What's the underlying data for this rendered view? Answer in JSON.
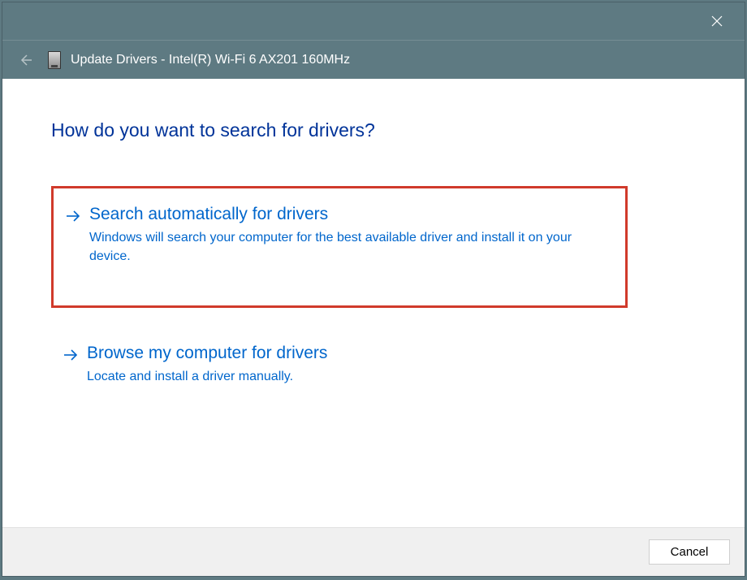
{
  "window": {
    "title": "Update Drivers - Intel(R) Wi-Fi 6 AX201 160MHz"
  },
  "main": {
    "heading": "How do you want to search for drivers?",
    "options": [
      {
        "title": "Search automatically for drivers",
        "description": "Windows will search your computer for the best available driver and install it on your device."
      },
      {
        "title": "Browse my computer for drivers",
        "description": "Locate and install a driver manually."
      }
    ]
  },
  "footer": {
    "cancel_label": "Cancel"
  }
}
